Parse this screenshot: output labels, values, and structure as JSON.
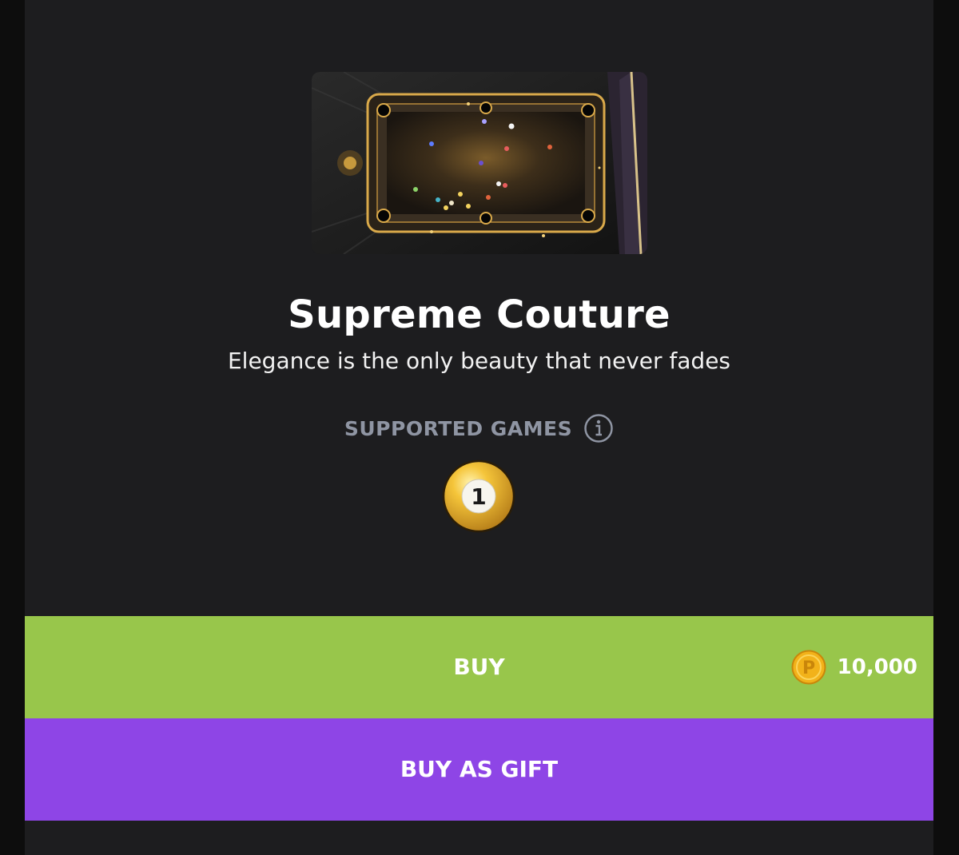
{
  "item": {
    "name": "Supreme Couture",
    "tagline": "Elegance is the only beauty that never fades"
  },
  "supported_games": {
    "label": "SUPPORTED GAMES",
    "info_icon": "info-icon",
    "games": [
      {
        "icon": "8-ball-pool-ball-1-icon",
        "number": "1"
      }
    ]
  },
  "actions": {
    "buy_label": "BUY",
    "price": "10,000",
    "currency_icon": "coin-icon",
    "gift_label": "BUY AS GIFT"
  },
  "colors": {
    "background": "#1d1d1f",
    "buy": "#98c64b",
    "gift": "#8e45e6",
    "muted_text": "#8f95a3",
    "coin": "#f2b21a"
  }
}
